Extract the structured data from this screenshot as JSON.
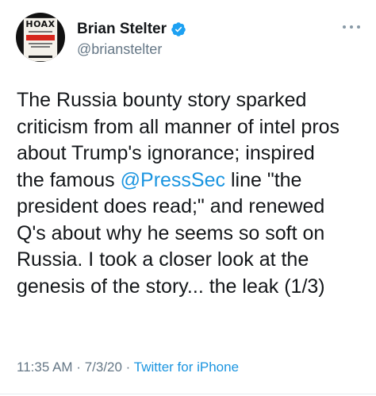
{
  "author": {
    "display_name": "Brian Stelter",
    "handle": "@brianstelter",
    "verified": true,
    "avatar_book_title": "HOAX",
    "avatar_band_text": "FOX NEWS"
  },
  "tweet": {
    "lines": [
      {
        "before": "The Russia bounty story sparked",
        "mention": "",
        "after": ""
      },
      {
        "before": "criticism from all manner of intel pros",
        "mention": "",
        "after": ""
      },
      {
        "before": "about Trump's ignorance; inspired",
        "mention": "",
        "after": ""
      },
      {
        "before": "the famous ",
        "mention": "@PressSec",
        "after": " line \"the"
      },
      {
        "before": "president does read;\" and renewed",
        "mention": "",
        "after": ""
      },
      {
        "before": "Q's about why he seems so soft on",
        "mention": "",
        "after": ""
      },
      {
        "before": "Russia. I took a closer look at the",
        "mention": "",
        "after": ""
      },
      {
        "before": "genesis of the story... the leak (1/3)",
        "mention": "",
        "after": ""
      }
    ]
  },
  "meta": {
    "time": "11:35 AM",
    "sep1": " · ",
    "date": "7/3/20",
    "sep2": " · ",
    "source": "Twitter for iPhone"
  },
  "icons": {
    "verified": "verified-badge-icon",
    "more": "more-options-icon"
  },
  "colors": {
    "link": "#1b95e0",
    "verified": "#1da1f2",
    "secondary_text": "#657786",
    "primary_text": "#14171a"
  }
}
